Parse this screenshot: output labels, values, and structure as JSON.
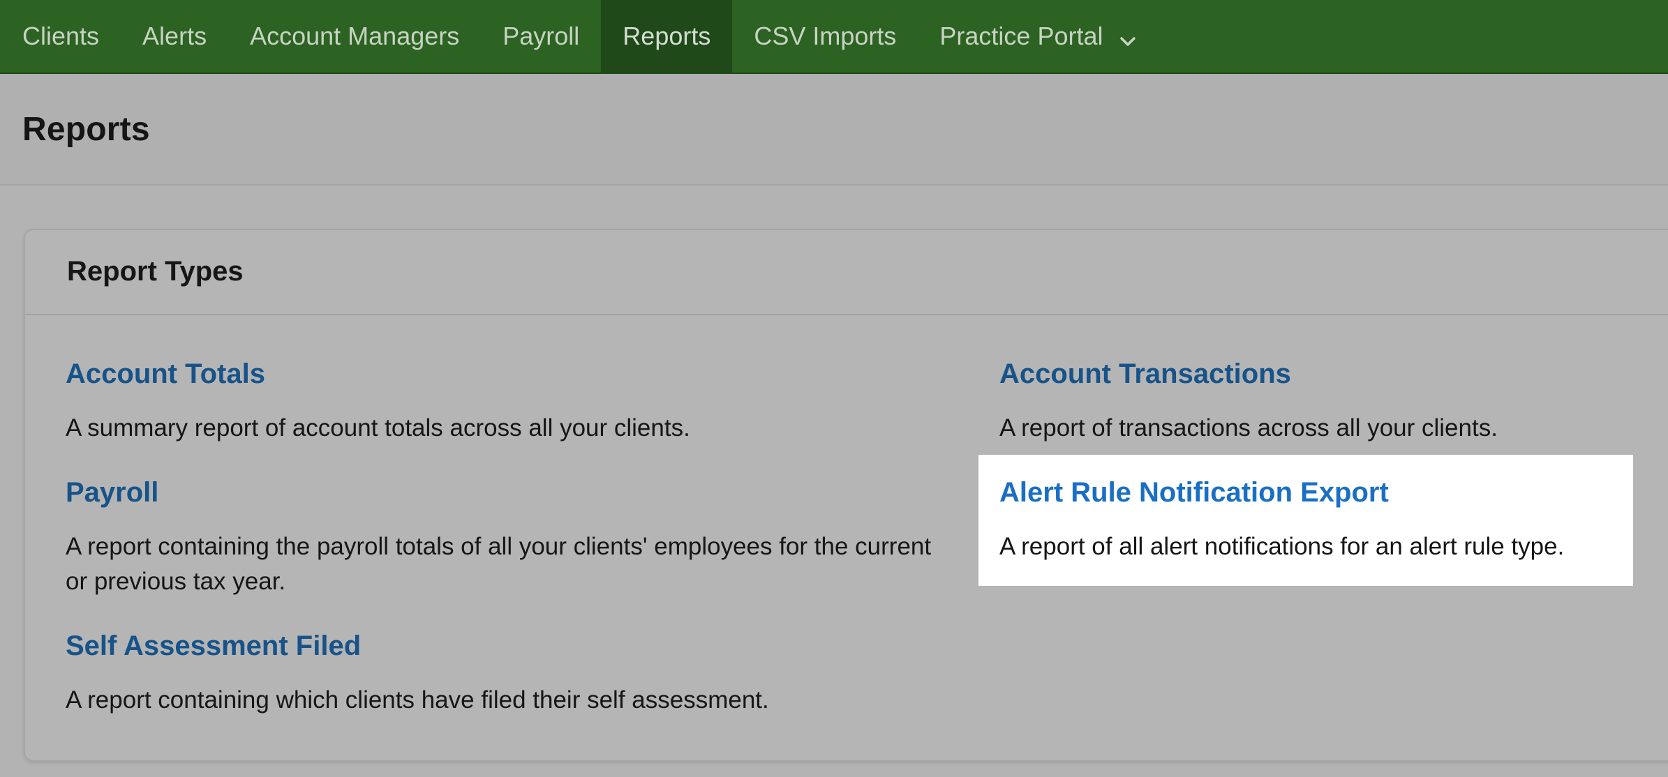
{
  "nav": {
    "items": [
      {
        "label": "Clients"
      },
      {
        "label": "Alerts"
      },
      {
        "label": "Account Managers"
      },
      {
        "label": "Payroll"
      },
      {
        "label": "Reports"
      },
      {
        "label": "CSV Imports"
      },
      {
        "label": "Practice Portal"
      }
    ],
    "active": "Reports",
    "dropdown_icon": "chevron-down-icon"
  },
  "page": {
    "title": "Reports"
  },
  "card": {
    "title": "Report Types"
  },
  "reports": {
    "account_totals": {
      "title": "Account Totals",
      "description": "A summary report of account totals across all your clients."
    },
    "account_transactions": {
      "title": "Account Transactions",
      "description": "A report of transactions across all your clients."
    },
    "payroll": {
      "title": "Payroll",
      "description": "A report containing the payroll totals of all your clients' employees for the current or previous tax year."
    },
    "alert_rule_export": {
      "title": "Alert Rule Notification Export",
      "description": "A report of all alert notifications for an alert rule type."
    },
    "self_assessment": {
      "title": "Self Assessment Filed",
      "description": "A report containing which clients have filed their self assessment."
    }
  },
  "colors": {
    "nav_bg": "#2c6222",
    "nav_active_bg": "#1f4919",
    "link": "#175389",
    "highlight_link": "#1a6fc4",
    "overlay_bg": "#b3b3b3"
  }
}
